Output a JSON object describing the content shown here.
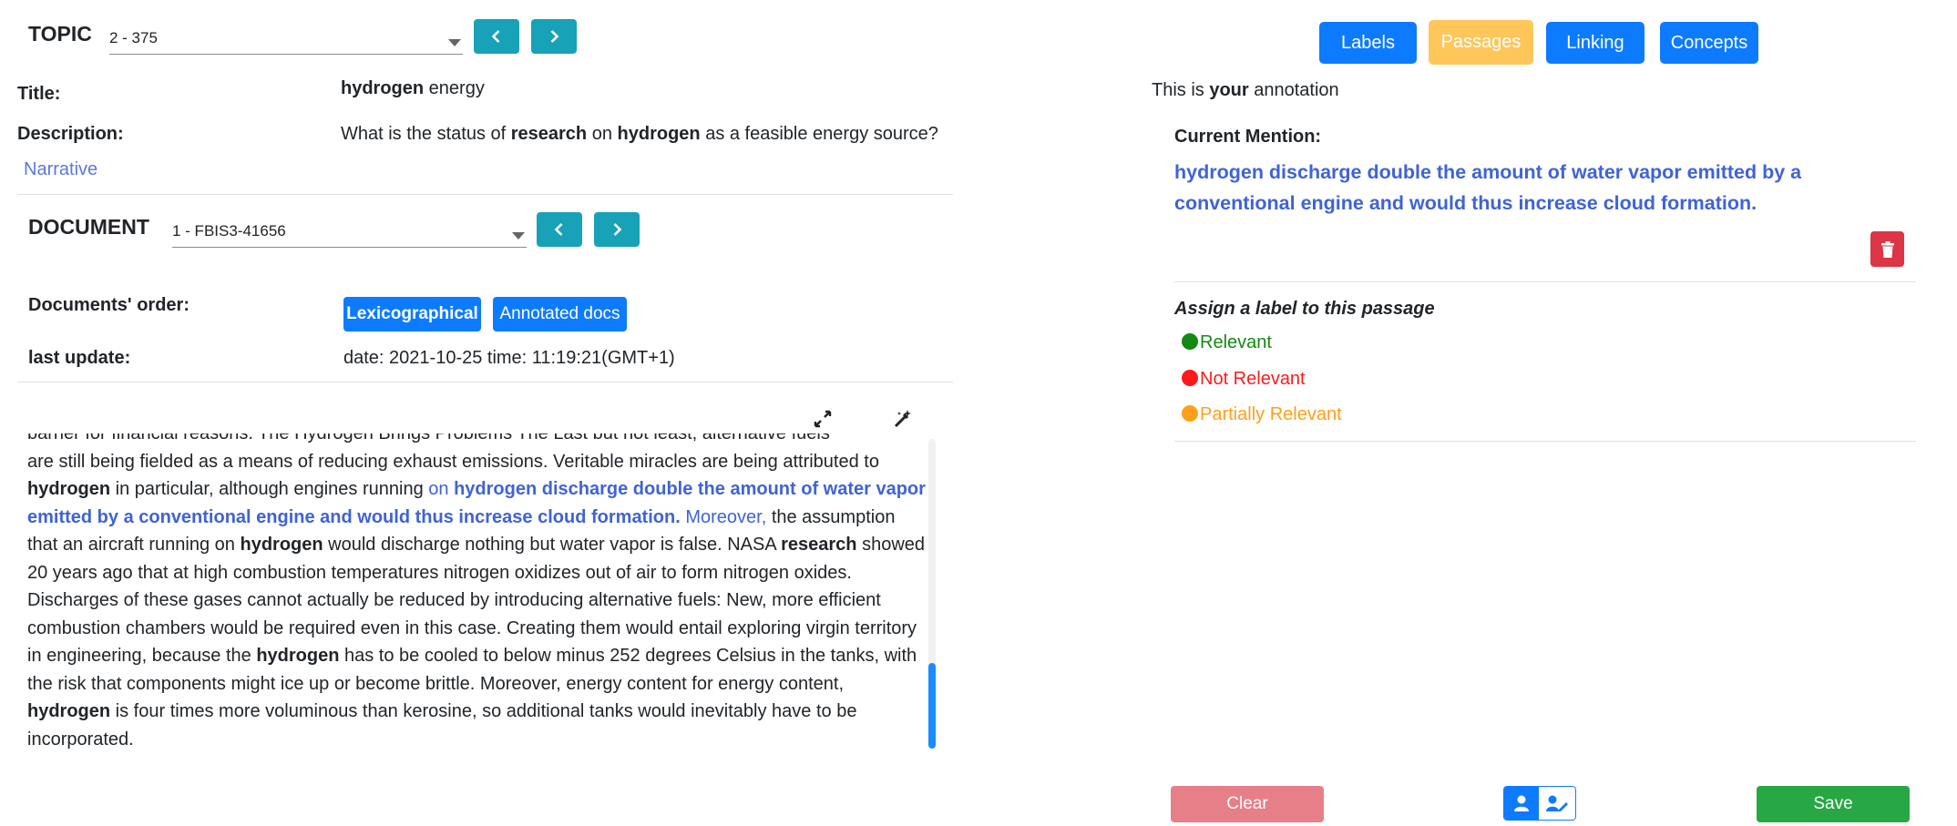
{
  "topic": {
    "heading": "TOPIC",
    "selected": "2 - 375",
    "title_label": "Title:",
    "title_bold": "hydrogen",
    "title_rest": " energy",
    "description_label": "Description:",
    "description_parts": [
      "What is the status of ",
      "research",
      " on ",
      "hydrogen",
      " as a feasible energy source?"
    ],
    "narrative_link": "Narrative"
  },
  "document": {
    "heading": "DOCUMENT",
    "selected": "1 - FBIS3-41656",
    "order_label": "Documents' order:",
    "order_buttons": [
      "Lexicographical",
      "Annotated docs"
    ],
    "last_update_label": "last update:",
    "last_update_value": "date: 2021-10-25 time: 11:19:21(GMT+1)"
  },
  "doc_text": {
    "line0": "barrier  for financial reasons.    The      Hydrogen Brings Problems    The      Last but not least,   alternative   fuels",
    "p1": "are still being fielded as a means of reducing exhaust emissions. Veritable miracles are being attributed to ",
    "w_hydrogen": "hydrogen",
    "p2": " in particular, although engines running ",
    "hl_on": "on ",
    "hl_bold": "hydrogen discharge double the amount of water vapor emitted by a conventional engine and would thus increase cloud formation.",
    "hl_moreover": " Moreover,",
    "p3": " the assumption that an aircraft running on ",
    "p4": " would discharge nothing but water vapor is false.   NASA ",
    "w_research": "research",
    "p5": " showed 20 years ago that at high combustion temperatures nitrogen oxidizes out of air to form nitrogen oxides. Discharges of these gases cannot actually be reduced by introducing alternative fuels: New, more efficient combustion chambers would be required even in this case. Creating them would entail exploring virgin territory in engineering, because the ",
    "p6": " has to be cooled to below minus 252 degrees Celsius in the tanks, with the risk that components might ice up or become brittle. Moreover, energy content for energy content, ",
    "p7": " is four times more voluminous than kerosine, so additional tanks would inevitably have to be incorporated."
  },
  "tabs": [
    "Labels",
    "Passages",
    "Linking",
    "Concepts"
  ],
  "annotation": {
    "intro_pre": "This is ",
    "intro_bold": "your",
    "intro_post": " annotation",
    "current_mention_label": "Current Mention:",
    "current_mention_text": "hydrogen discharge double the amount of water vapor emitted by a conventional engine and would thus increase cloud formation.",
    "assign_label": "Assign a label to this passage",
    "options": [
      {
        "label": "Relevant",
        "color": "#138a13"
      },
      {
        "label": "Not Relevant",
        "color": "#ff1a1a"
      },
      {
        "label": "Partially Relevant",
        "color": "#ff9f1a"
      }
    ]
  },
  "bottom": {
    "clear": "Clear",
    "save": "Save"
  },
  "colors": {
    "accent": "#0d7bff",
    "nav": "#17a2b8",
    "active_tab": "#ffc65a",
    "mention": "#3f63d6",
    "danger": "#dc3545",
    "success": "#28a745"
  }
}
